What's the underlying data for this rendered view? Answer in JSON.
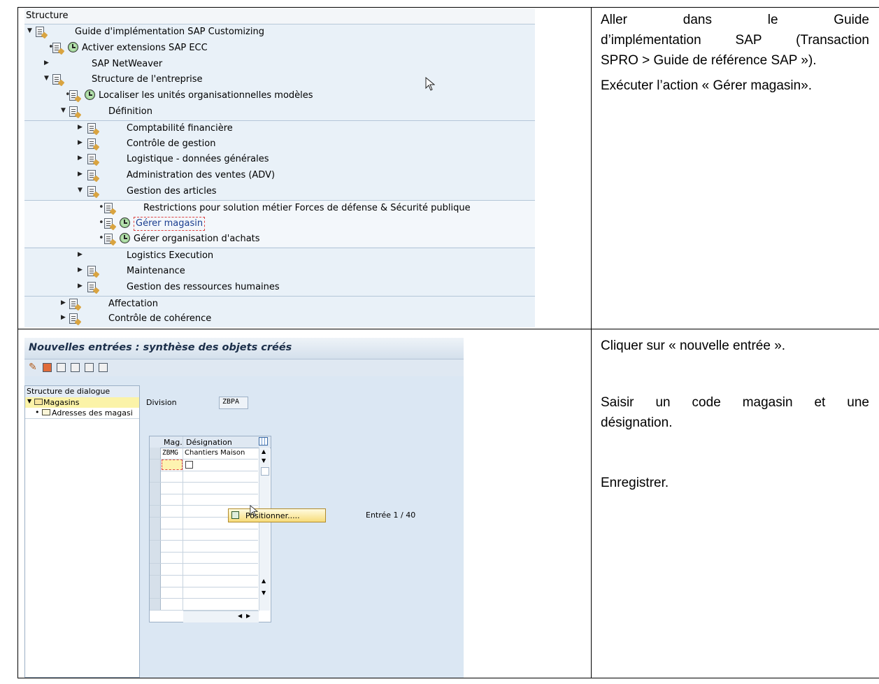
{
  "row1": {
    "tree": {
      "header": "Structure",
      "nodes": [
        {
          "label": "Guide d'implémentation SAP Customizing",
          "level": 0,
          "toggle": "▼",
          "doc": true,
          "clock": false
        },
        {
          "label": "Activer extensions SAP ECC",
          "level": 1,
          "toggle": "•",
          "doc": true,
          "clock": true
        },
        {
          "label": "SAP NetWeaver",
          "level": 1,
          "toggle": "▶",
          "doc": false,
          "clock": false
        },
        {
          "label": "Structure de l'entreprise",
          "level": 1,
          "toggle": "▼",
          "doc": true,
          "clock": false
        },
        {
          "label": "Localiser les unités organisationnelles modèles",
          "level": 2,
          "toggle": "•",
          "doc": true,
          "clock": true
        },
        {
          "label": "Définition",
          "level": 2,
          "toggle": "▼",
          "doc": true,
          "clock": false
        },
        {
          "label": "Comptabilité financière",
          "level": 3,
          "toggle": "▶",
          "doc": true,
          "clock": false
        },
        {
          "label": "Contrôle de gestion",
          "level": 3,
          "toggle": "▶",
          "doc": true,
          "clock": false
        },
        {
          "label": "Logistique - données générales",
          "level": 3,
          "toggle": "▶",
          "doc": true,
          "clock": false
        },
        {
          "label": "Administration des ventes (ADV)",
          "level": 3,
          "toggle": "▶",
          "doc": true,
          "clock": false
        },
        {
          "label": "Gestion des articles",
          "level": 3,
          "toggle": "▼",
          "doc": true,
          "clock": false
        },
        {
          "label": "Restrictions pour solution métier Forces de défense & Sécurité publique",
          "level": 4,
          "toggle": "•",
          "doc": true,
          "clock": false
        },
        {
          "label": "Gérer magasin",
          "level": 4,
          "toggle": "•",
          "doc": true,
          "clock": true,
          "selected": true
        },
        {
          "label": "Gérer organisation d'achats",
          "level": 4,
          "toggle": "•",
          "doc": true,
          "clock": true
        },
        {
          "label": "Logistics Execution",
          "level": 3,
          "toggle": "▶",
          "doc": false,
          "clock": false
        },
        {
          "label": "Maintenance",
          "level": 3,
          "toggle": "▶",
          "doc": true,
          "clock": false
        },
        {
          "label": "Gestion des ressources humaines",
          "level": 3,
          "toggle": "▶",
          "doc": true,
          "clock": false
        },
        {
          "label": "Affectation",
          "level": 2,
          "toggle": "▶",
          "doc": true,
          "clock": false
        },
        {
          "label": "Contrôle de cohérence",
          "level": 2,
          "toggle": "▶",
          "doc": true,
          "clock": false
        }
      ]
    },
    "instructions": {
      "p1_line1": "Aller dans le Guide",
      "p1_line2": "d’implémentation SAP (Transaction",
      "p1_line3": "SPRO > Guide de référence SAP »).",
      "p2": "Exécuter l’action « Gérer magasin»."
    }
  },
  "row2": {
    "screen": {
      "title": "Nouvelles entrées : synthèse des objets créés",
      "dialog_header": "Structure de dialogue",
      "dialog_item1": "Magasins",
      "dialog_item2": "Adresses des magasi",
      "division_label": "Division",
      "division_value": "ZBPA",
      "col_mag": "Mag.",
      "col_designation": "Désignation",
      "row1_mag": "ZBMG",
      "row1_designation": "Chantiers Maison",
      "position_button": "Positionner.....",
      "entry_counter": "Entrée 1 / 40"
    },
    "instructions": {
      "p1": "Cliquer sur « nouvelle entrée ».",
      "p2_line1": "Saisir un code magasin et une",
      "p2_line2": "désignation.",
      "p3": "Enregistrer."
    }
  }
}
